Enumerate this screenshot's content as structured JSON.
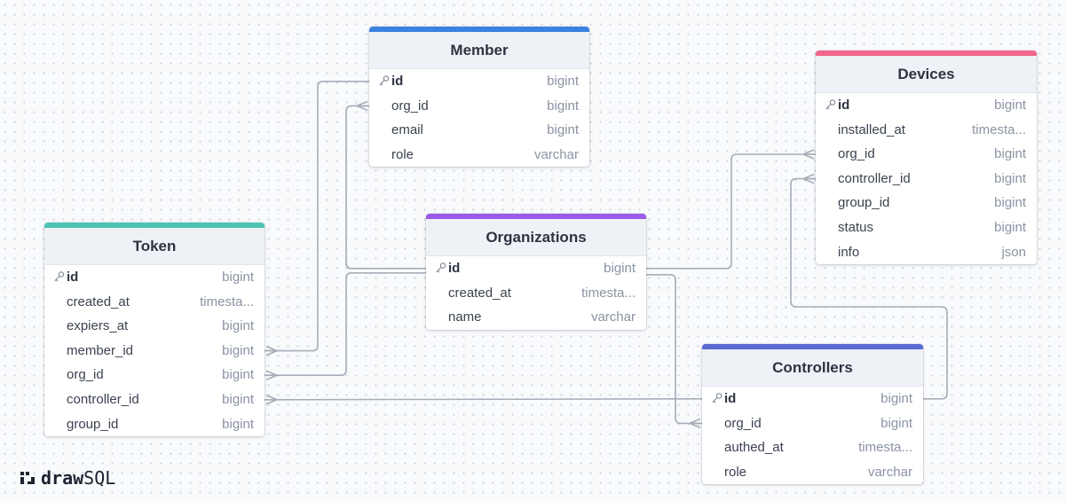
{
  "app": {
    "logo_bold": "draw",
    "logo_light": "SQL"
  },
  "colors": {
    "Member": "#3b82e0",
    "Devices": "#f2668b",
    "Token": "#4cc3b3",
    "Organizations": "#9a5be6",
    "Controllers": "#5a6bd2"
  },
  "tables": [
    {
      "name": "Member",
      "columns": [
        {
          "name": "id",
          "type": "bigint",
          "pk": true
        },
        {
          "name": "org_id",
          "type": "bigint"
        },
        {
          "name": "email",
          "type": "bigint"
        },
        {
          "name": "role",
          "type": "varchar"
        }
      ]
    },
    {
      "name": "Devices",
      "columns": [
        {
          "name": "id",
          "type": "bigint",
          "pk": true
        },
        {
          "name": "installed_at",
          "type": "timesta..."
        },
        {
          "name": "org_id",
          "type": "bigint"
        },
        {
          "name": "controller_id",
          "type": "bigint"
        },
        {
          "name": "group_id",
          "type": "bigint"
        },
        {
          "name": "status",
          "type": "bigint"
        },
        {
          "name": "info",
          "type": "json"
        }
      ]
    },
    {
      "name": "Token",
      "columns": [
        {
          "name": "id",
          "type": "bigint",
          "pk": true
        },
        {
          "name": "created_at",
          "type": "timesta..."
        },
        {
          "name": "expiers_at",
          "type": "bigint"
        },
        {
          "name": "member_id",
          "type": "bigint"
        },
        {
          "name": "org_id",
          "type": "bigint"
        },
        {
          "name": "controller_id",
          "type": "bigint"
        },
        {
          "name": "group_id",
          "type": "bigint"
        }
      ]
    },
    {
      "name": "Organizations",
      "columns": [
        {
          "name": "id",
          "type": "bigint",
          "pk": true
        },
        {
          "name": "created_at",
          "type": "timesta..."
        },
        {
          "name": "name",
          "type": "varchar"
        }
      ]
    },
    {
      "name": "Controllers",
      "columns": [
        {
          "name": "id",
          "type": "bigint",
          "pk": true
        },
        {
          "name": "org_id",
          "type": "bigint"
        },
        {
          "name": "authed_at",
          "type": "timesta..."
        },
        {
          "name": "role",
          "type": "varchar"
        }
      ]
    }
  ],
  "relations": [
    {
      "from": "Token.member_id",
      "to": "Member.id"
    },
    {
      "from": "Member.org_id",
      "to": "Organizations.id"
    },
    {
      "from": "Token.org_id",
      "to": "Organizations.id"
    },
    {
      "from": "Devices.org_id",
      "to": "Organizations.id"
    },
    {
      "from": "Controllers.org_id",
      "to": "Organizations.id"
    },
    {
      "from": "Devices.controller_id",
      "to": "Controllers.id"
    },
    {
      "from": "Token.controller_id",
      "to": "Controllers.id"
    }
  ]
}
